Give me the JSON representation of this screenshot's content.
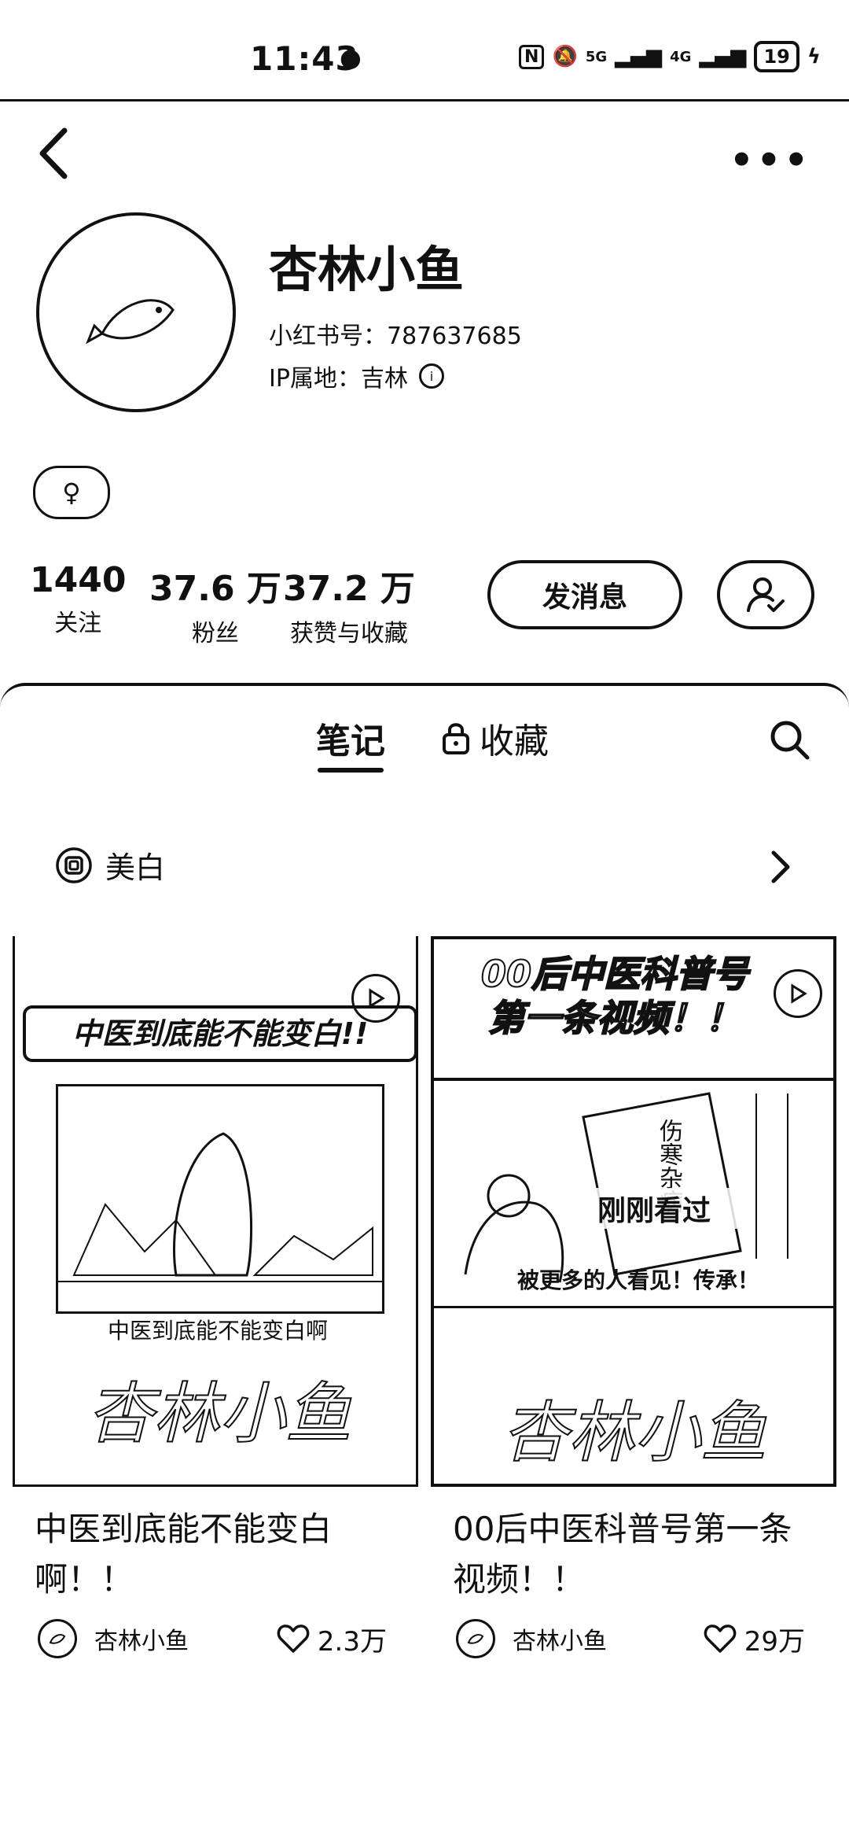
{
  "status": {
    "time": "11:43",
    "net_5g": "5G",
    "net_4g": "4G",
    "battery": "19"
  },
  "profile": {
    "nickname": "杏林小鱼",
    "red_id": "小红书号：787637685",
    "ip": "IP属地：吉林"
  },
  "stats": [
    {
      "num": "1440",
      "label": "关注"
    },
    {
      "num": "37.6 万",
      "label": "粉丝"
    },
    {
      "num": "37.2 万",
      "label": "获赞与收藏"
    }
  ],
  "actions": {
    "message": "发消息"
  },
  "tabs": {
    "notes": "笔记",
    "favorites": "收藏"
  },
  "collection": {
    "label": "美白"
  },
  "notes": [
    {
      "cover_title": "中医到底能不能变白!!",
      "cover_subtitle": "中医到底能不能变白啊",
      "watermark": "杏林小鱼",
      "title": "中医到底能不能变白啊！！",
      "author": "杏林小鱼",
      "likes": "2.3万"
    },
    {
      "cover_title_line1": "00后中医科普号",
      "cover_title_line2": "第一条视频！！",
      "recent_badge": "刚刚看过",
      "cover_caption": "被更多的人看见！传承！",
      "book_text": "伤寒杂病",
      "watermark": "杏林小鱼",
      "title": "00后中医科普号第一条视频！！",
      "author": "杏林小鱼",
      "likes": "29万"
    }
  ]
}
